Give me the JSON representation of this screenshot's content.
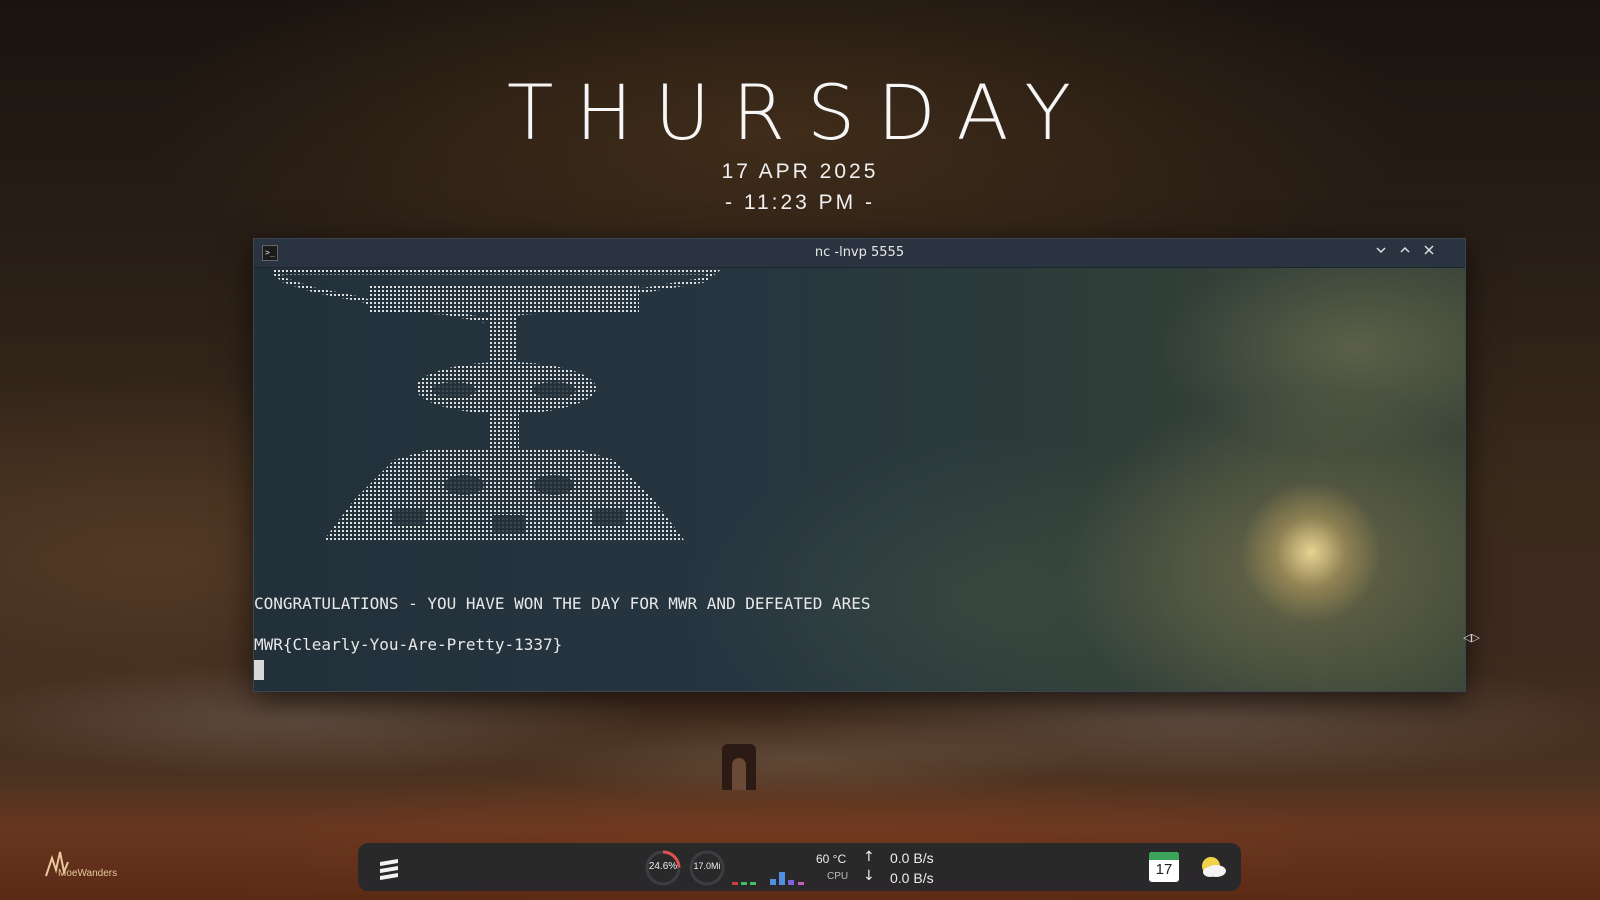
{
  "clock": {
    "day": "THURSDAY",
    "date": "17 APR 2025",
    "time": "- 11:23 PM -"
  },
  "window": {
    "title": "nc -lnvp 5555",
    "icon": "terminal-icon",
    "buttons": [
      "chevron-down-icon",
      "chevron-up-icon",
      "close-icon"
    ]
  },
  "terminal": {
    "message": "CONGRATULATIONS - YOU HAVE WON THE DAY FOR MWR AND DEFEATED ARES",
    "flag": "MWR{Clearly-You-Are-Pretty-1337}"
  },
  "desktop": {
    "logo_text": "MoeWanders"
  },
  "taskbar": {
    "menu_icon": "hamburger-menu-icon",
    "cpu_usage": "24.6%",
    "cpu_usage_fraction": 0.246,
    "memory": "17.0Mi",
    "temperature": "60 °C",
    "cpu_label": "CPU",
    "upload": "0.0 B/s",
    "download": "0.0 B/s",
    "calendar_day": "17",
    "calendar_icon": "calendar-icon",
    "weather_icon": "partly-cloudy-icon"
  },
  "colors": {
    "taskbar_bg": "#26282c",
    "titlebar_bg": "#2a3440",
    "cpu_gauge": "#e05050",
    "calendar_accent": "#3aa55a"
  }
}
